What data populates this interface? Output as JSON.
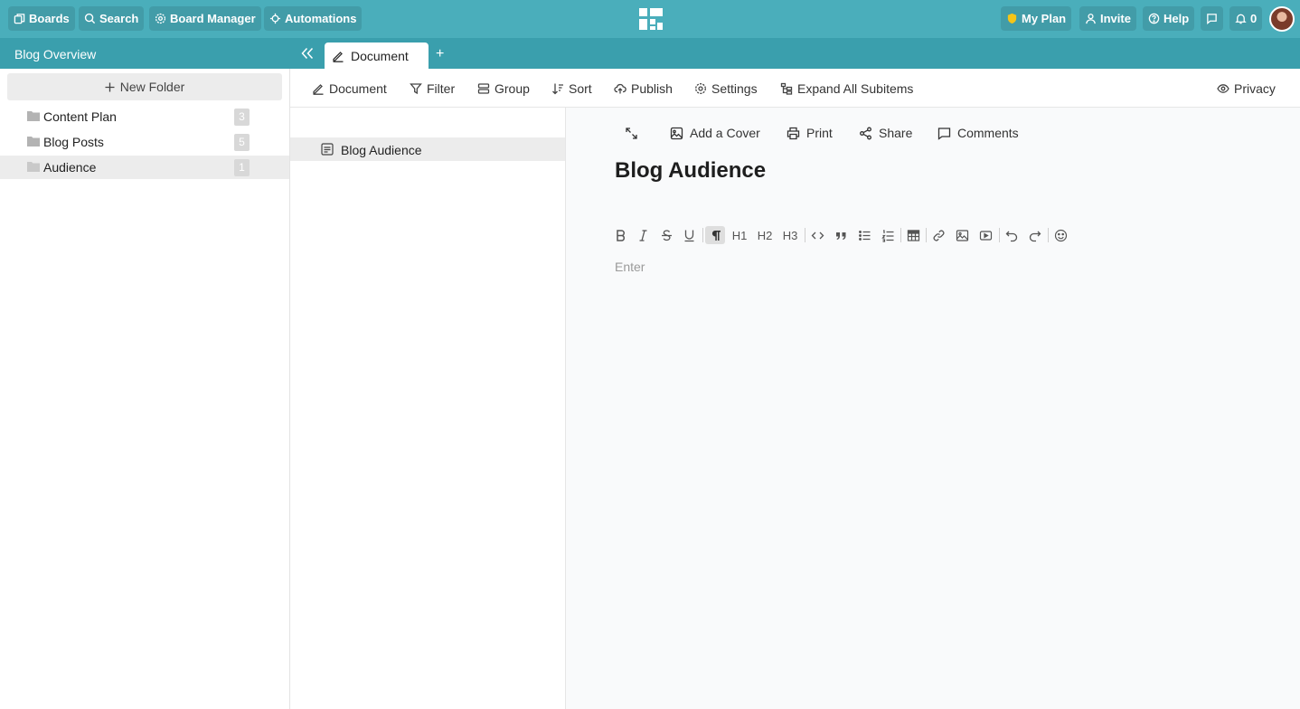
{
  "topbar": {
    "boards_label": "Boards",
    "search_label": "Search",
    "board_manager_label": "Board Manager",
    "automations_label": "Automations",
    "my_plan_label": "My Plan",
    "invite_label": "Invite",
    "help_label": "Help",
    "notifications_count": "0",
    "brand_color": "#4aaebb",
    "plan_badge_color": "#f5c518"
  },
  "subbar": {
    "board_title": "Blog Overview",
    "active_tab_label": "Document",
    "add_tab_label": "+"
  },
  "sidebar": {
    "new_folder_label": "New Folder",
    "folders": [
      {
        "label": "Content Plan",
        "count": "3"
      },
      {
        "label": "Blog Posts",
        "count": "5"
      },
      {
        "label": "Audience",
        "count": "1"
      }
    ]
  },
  "toolbar": {
    "document_label": "Document",
    "filter_label": "Filter",
    "group_label": "Group",
    "sort_label": "Sort",
    "publish_label": "Publish",
    "settings_label": "Settings",
    "expand_label": "Expand All Subitems",
    "privacy_label": "Privacy"
  },
  "list": {
    "items": [
      {
        "label": "Blog Audience"
      }
    ]
  },
  "document": {
    "add_cover_label": "Add a Cover",
    "print_label": "Print",
    "share_label": "Share",
    "comments_label": "Comments",
    "title": "Blog Audience",
    "placeholder": "Enter",
    "editor": {
      "h1": "H1",
      "h2": "H2",
      "h3": "H3"
    }
  }
}
